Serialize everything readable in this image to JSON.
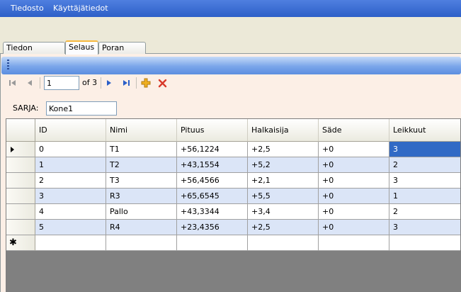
{
  "menu": {
    "items": [
      "Tiedosto",
      "Käyttäjätiedot"
    ]
  },
  "tabs": [
    {
      "label": "Tiedon tallennus",
      "active": false
    },
    {
      "label": "Selaus",
      "active": true
    },
    {
      "label": "Poran tyyppi",
      "active": false
    }
  ],
  "navigator": {
    "position": "1",
    "of_label": "of 3",
    "icons": [
      "move-first-icon",
      "move-previous-icon",
      "move-next-icon",
      "move-last-icon",
      "add-new-icon",
      "delete-icon"
    ]
  },
  "sarja": {
    "label": "SARJA:",
    "value": "Kone1"
  },
  "grid": {
    "columns": [
      "ID",
      "Nimi",
      "Pituus",
      "Halkaisija",
      "Säde",
      "Leikkuut"
    ],
    "rows": [
      [
        "0",
        "T1",
        "+56,1224",
        "+2,5",
        "+0",
        "3"
      ],
      [
        "1",
        "T2",
        "+43,1554",
        "+5,2",
        "+0",
        "2"
      ],
      [
        "2",
        "T3",
        "+56,4566",
        "+2,1",
        "+0",
        "3"
      ],
      [
        "3",
        "R3",
        "+65,6545",
        "+5,5",
        "+0",
        "1"
      ],
      [
        "4",
        "Pallo",
        "+43,3344",
        "+3,4",
        "+0",
        "2"
      ],
      [
        "5",
        "R4",
        "+23,4356",
        "+2,5",
        "+0",
        "3"
      ]
    ],
    "current_row": 0,
    "selected_cell": {
      "row": 0,
      "col": 5
    },
    "new_row_glyph": "✱"
  },
  "colors": {
    "menubar": "#2d5fc8",
    "selection": "#316ac5",
    "alt_row": "#dbe5f7",
    "delete_red": "#d83a2a",
    "add_yellow": "#f0b020"
  }
}
